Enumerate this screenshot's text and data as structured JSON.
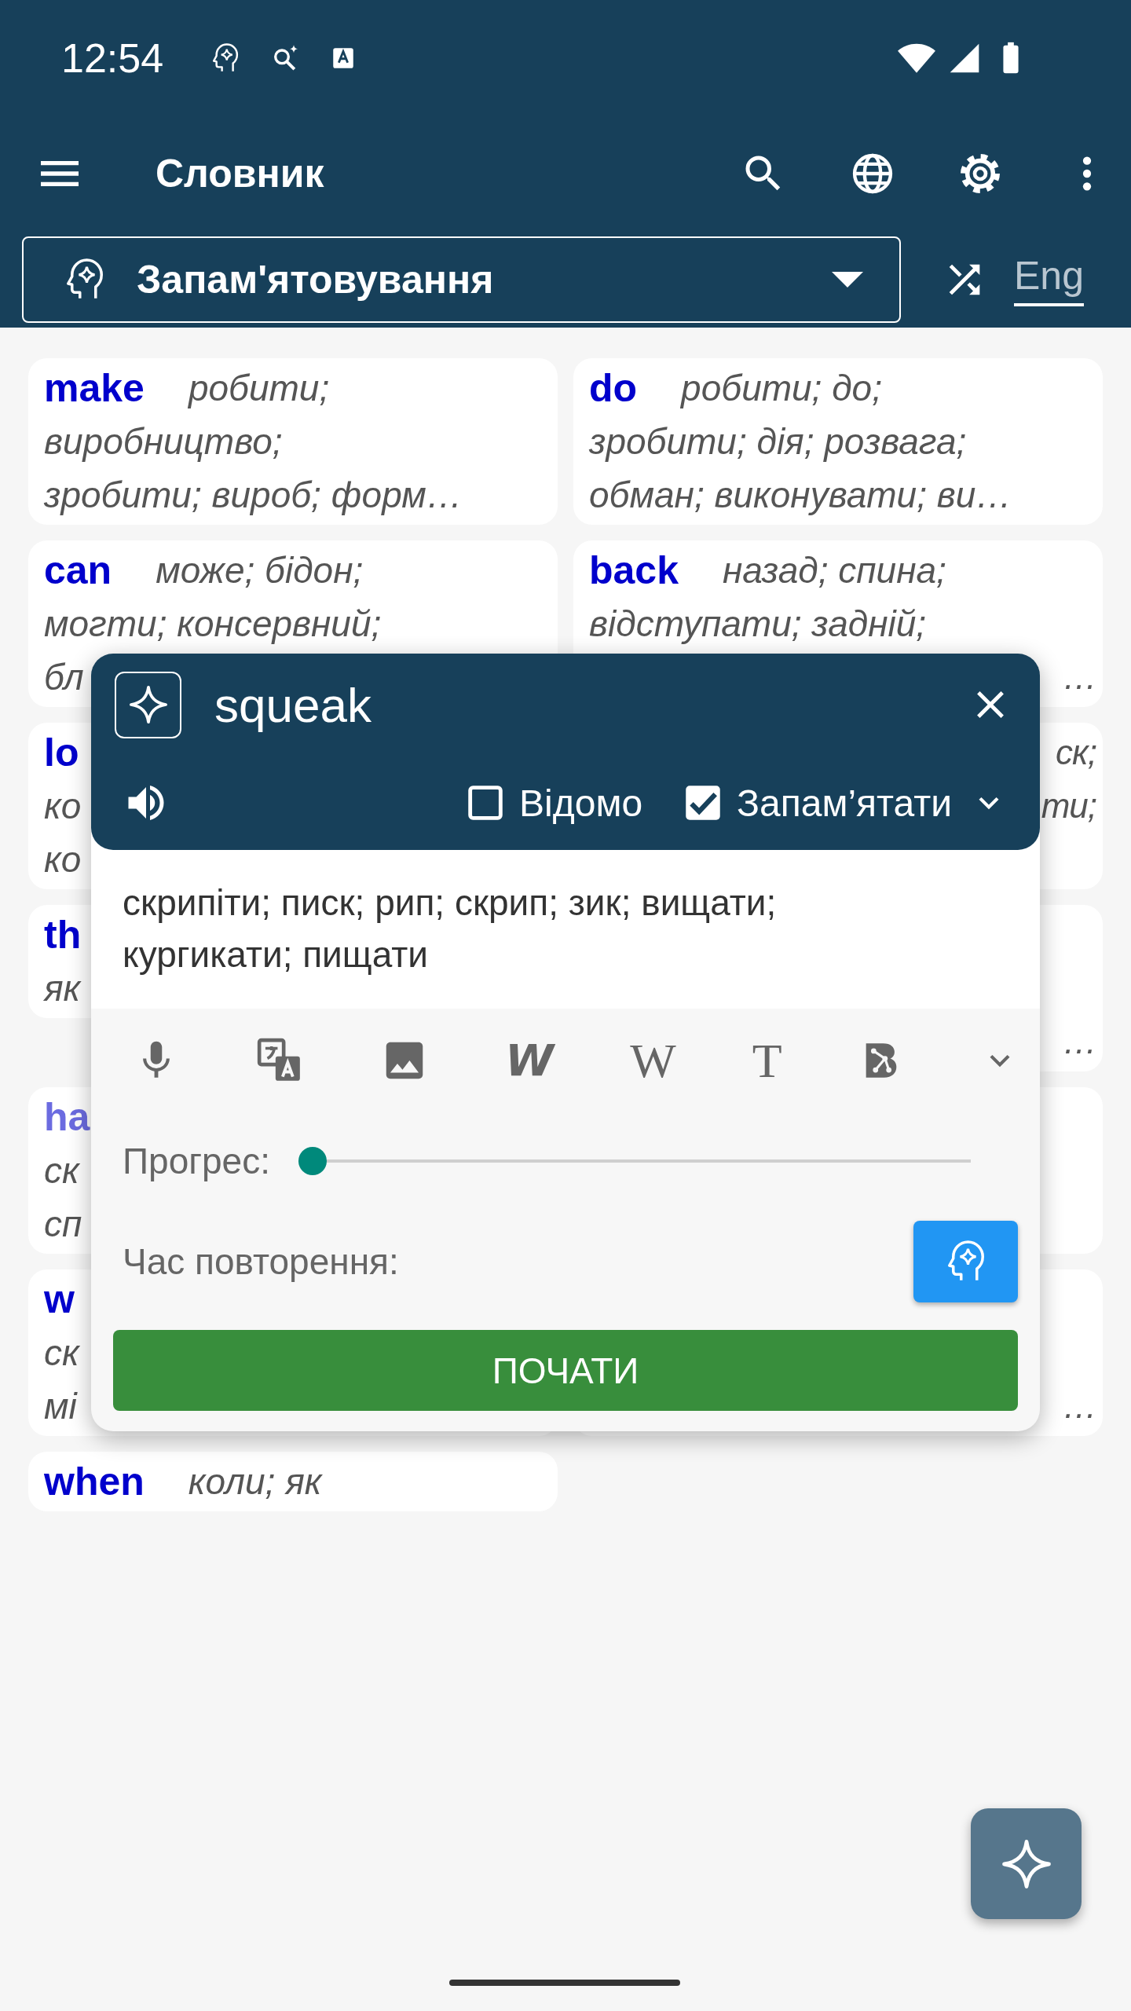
{
  "status_bar": {
    "time": "12:54"
  },
  "app_bar": {
    "title": "Словник"
  },
  "filter": {
    "mode": "Запам'ятовування",
    "language": "Eng"
  },
  "cards": [
    {
      "word": "make",
      "color": "#0000cc",
      "lines": [
        {
          "kind": "start",
          "text": "робити;"
        },
        {
          "kind": "start",
          "text": "виробництво;"
        },
        {
          "kind": "start",
          "text": "зробити; вироб; форм…"
        }
      ]
    },
    {
      "word": "do",
      "color": "#0000cc",
      "lines": [
        {
          "kind": "start",
          "text": "робити; до;"
        },
        {
          "kind": "start",
          "text": "зробити; дія; розвага;"
        },
        {
          "kind": "start",
          "text": "обман; виконувати; ви…"
        }
      ]
    },
    {
      "word": "can",
      "color": "#0000cc",
      "lines": [
        {
          "kind": "start",
          "text": "може; бідон;"
        },
        {
          "kind": "start",
          "text": "могти; консервний;"
        },
        {
          "kind": "start",
          "text": "бл"
        }
      ]
    },
    {
      "word": "back",
      "color": "#0000cc",
      "lines": [
        {
          "kind": "start",
          "text": "назад; спина;"
        },
        {
          "kind": "start",
          "text": "відступати; задній;"
        },
        {
          "kind": "end",
          "text": "…"
        }
      ]
    },
    {
      "word": "lo",
      "color": "#0000cc",
      "lines": [
        {
          "kind": "covered"
        },
        {
          "kind": "start",
          "text": "ко"
        },
        {
          "kind": "start",
          "text": "ко"
        }
      ]
    },
    {
      "lines": [
        {
          "kind": "end",
          "text": "ск;"
        },
        {
          "kind": "end",
          "text": "ти;"
        },
        {
          "kind": "covered"
        }
      ]
    },
    {
      "word": "th",
      "color": "#0000cc",
      "lines": [
        {
          "kind": "covered"
        },
        {
          "kind": "start",
          "text": "як"
        }
      ]
    },
    {
      "lines": [
        {
          "kind": "covered"
        },
        {
          "kind": "covered"
        },
        {
          "kind": "end",
          "text": "…"
        }
      ]
    },
    {
      "word": "ha",
      "color": "#6b6be0",
      "lines": [
        {
          "kind": "covered"
        },
        {
          "kind": "start",
          "text": "ск"
        },
        {
          "kind": "start",
          "text": "сп"
        }
      ]
    },
    {
      "lines": [
        {
          "kind": "covered"
        },
        {
          "kind": "covered"
        },
        {
          "kind": "covered"
        }
      ]
    },
    {
      "word": "w",
      "color": "#0000cc",
      "lines": [
        {
          "kind": "covered"
        },
        {
          "kind": "start",
          "text": "ск"
        },
        {
          "kind": "start",
          "text": "мі"
        }
      ]
    },
    {
      "lines": [
        {
          "kind": "covered"
        },
        {
          "kind": "covered"
        },
        {
          "kind": "end",
          "text": "…"
        }
      ]
    },
    {
      "word": "when",
      "color": "#0000cc",
      "lines": [
        {
          "kind": "start",
          "text": "коли; як"
        }
      ]
    }
  ],
  "dialog": {
    "word": "squeak",
    "known": {
      "label": "Відомо",
      "checked": false
    },
    "remember": {
      "label": "Запам’ятати",
      "checked": true
    },
    "translation": "скрипіти; писк; рип; скрип; зик; вищати; кургикати; пищати",
    "toolbar": [
      {
        "kind": "mic"
      },
      {
        "kind": "translate"
      },
      {
        "kind": "image"
      },
      {
        "kind": "glyph-italic",
        "text": "W"
      },
      {
        "kind": "glyph-serif",
        "text": "W"
      },
      {
        "kind": "glyph-serif",
        "text": "T"
      },
      {
        "kind": "graph"
      },
      {
        "kind": "more"
      }
    ],
    "progress": {
      "label": "Прогрес:",
      "level": 0
    },
    "review": {
      "label": "Час повторення:"
    },
    "start_button": "ПОЧАТИ"
  }
}
